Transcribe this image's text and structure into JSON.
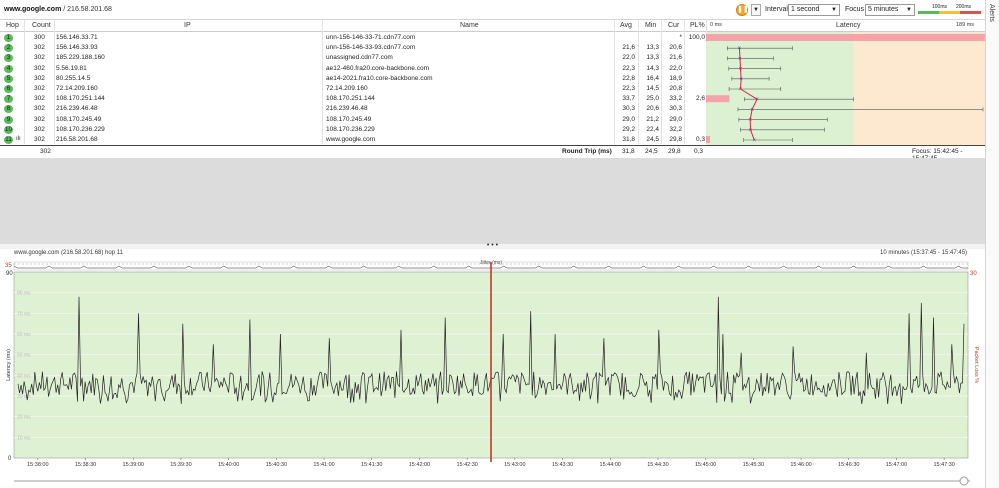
{
  "toolbar": {
    "target_host": "www.google.com",
    "target_sep": " / ",
    "target_ip": "216.58.201.68",
    "pause_icon": "pause-icon",
    "interval_label": "Interval",
    "interval_value": "1 second",
    "focus_label": "Focus",
    "focus_value": "5 minutes",
    "scale_100": "100ms",
    "scale_200": "200ms",
    "scale_colors": [
      "#5cb85c",
      "#f0c040",
      "#d9534f"
    ]
  },
  "alerts_label": "Alerts",
  "table": {
    "headers": {
      "hop": "Hop",
      "count": "Count",
      "ip": "IP",
      "name": "Name",
      "avg": "Avg",
      "min": "Min",
      "cur": "Cur",
      "pl": "PL%",
      "latency_min": "0 ms",
      "latency": "Latency",
      "latency_max": "189 ms"
    },
    "rows": [
      {
        "hop": "1",
        "count": "300",
        "ip": "156.146.33.71",
        "name": "unn-156-146-33-71.cdn77.com",
        "avg": "",
        "min": "",
        "cur": "*",
        "pl": "100,0",
        "latency": null,
        "min_ms": null,
        "max_ms": null
      },
      {
        "hop": "2",
        "count": "302",
        "ip": "156.146.33.93",
        "name": "unn-156-146-33-93.cdn77.com",
        "avg": "21,6",
        "min": "13,3",
        "cur": "20,6",
        "pl": "",
        "latency": 21.6,
        "min_ms": 13.3,
        "max_ms": 58
      },
      {
        "hop": "3",
        "count": "302",
        "ip": "185.229.188.160",
        "name": "unassigned.cdn77.com",
        "avg": "22,0",
        "min": "13,3",
        "cur": "21,6",
        "pl": "",
        "latency": 22.0,
        "min_ms": 13.3,
        "max_ms": 45
      },
      {
        "hop": "4",
        "count": "302",
        "ip": "5.56.19.81",
        "name": "ae12-460.fra20.core-backbone.com",
        "avg": "22,3",
        "min": "14,3",
        "cur": "22,0",
        "pl": "",
        "latency": 22.3,
        "min_ms": 14.3,
        "max_ms": 50
      },
      {
        "hop": "5",
        "count": "302",
        "ip": "80.255.14.5",
        "name": "ae14-2021.fra10.core-backbone.com",
        "avg": "22,8",
        "min": "16,4",
        "cur": "18,9",
        "pl": "",
        "latency": 22.8,
        "min_ms": 16.4,
        "max_ms": 42
      },
      {
        "hop": "6",
        "count": "302",
        "ip": "72.14.209.160",
        "name": "72.14.209.160",
        "avg": "22,3",
        "min": "14,5",
        "cur": "20,8",
        "pl": "",
        "latency": 22.3,
        "min_ms": 14.5,
        "max_ms": 50
      },
      {
        "hop": "7",
        "count": "302",
        "ip": "108.170.251.144",
        "name": "108.170.251.144",
        "avg": "33,7",
        "min": "25,0",
        "cur": "33,2",
        "pl": "2,6",
        "latency": 33.7,
        "min_ms": 25.0,
        "max_ms": 100
      },
      {
        "hop": "8",
        "count": "302",
        "ip": "216.239.46.48",
        "name": "216.239.46.48",
        "avg": "30,3",
        "min": "20,6",
        "cur": "30,3",
        "pl": "",
        "latency": 30.3,
        "min_ms": 20.6,
        "max_ms": 189
      },
      {
        "hop": "9",
        "count": "302",
        "ip": "108.170.245.49",
        "name": "108.170.245.49",
        "avg": "29,0",
        "min": "21,2",
        "cur": "29,0",
        "pl": "",
        "latency": 29.0,
        "min_ms": 21.2,
        "max_ms": 82
      },
      {
        "hop": "10",
        "count": "302",
        "ip": "108.170.236.229",
        "name": "108.170.236.229",
        "avg": "29,2",
        "min": "22,4",
        "cur": "32,2",
        "pl": "",
        "latency": 29.2,
        "min_ms": 22.4,
        "max_ms": 80
      },
      {
        "hop": "11",
        "count": "302",
        "ip": "216.58.201.68",
        "name": "www.google.com",
        "avg": "31,8",
        "min": "24,5",
        "cur": "29,8",
        "pl": "0,3",
        "latency": 31.8,
        "min_ms": 24.5,
        "max_ms": 58
      }
    ],
    "summary": {
      "count": "302",
      "label": "Round Trip (ms)",
      "avg": "31,8",
      "min": "24,5",
      "cur": "29,8",
      "pl": "0,3",
      "focus": "Focus: 15:42:45 - 15:47:45"
    }
  },
  "graph": {
    "title": "www.google.com (216.58.201.68) hop 11",
    "range": "10 minutes (15:37:45 - 15:47:45)",
    "jitter_label": "Jitter (ms)",
    "jitter_max": "35",
    "pl_max": "30",
    "ylabel": "Latency (ms)",
    "ylabel_right": "Packet Loss %",
    "y_top": "90",
    "y_bottom": "0",
    "y_ticks": [
      "80 ms",
      "70 ms",
      "60 ms",
      "50 ms",
      "40 ms",
      "30 ms",
      "20 ms",
      "10 ms"
    ],
    "x_ticks": [
      "15:38:00",
      "15:38:30",
      "15:39:00",
      "15:39:30",
      "15:40:00",
      "15:40:30",
      "15:41:00",
      "15:41:30",
      "15:42:00",
      "15:42:30",
      "15:43:00",
      "15:43:30",
      "15:44:00",
      "15:44:30",
      "15:45:00",
      "15:45:30",
      "15:46:00",
      "15:46:30",
      "15:47:00",
      "15:47:30"
    ],
    "focus_marker_time": "15:42:45"
  }
}
